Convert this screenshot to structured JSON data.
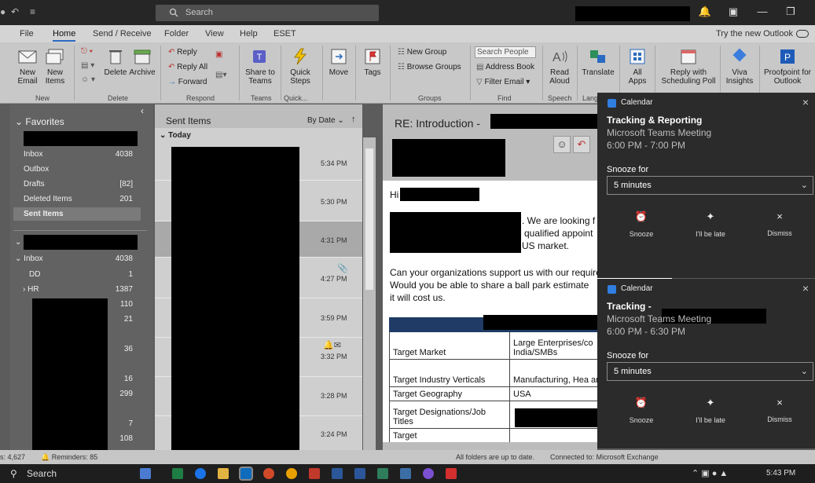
{
  "titlebar": {
    "search_placeholder": "Search"
  },
  "tabs": [
    "File",
    "Home",
    "Send / Receive",
    "Folder",
    "View",
    "Help",
    "ESET"
  ],
  "try_new": "Try the new Outlook",
  "ribbon": {
    "new_email": "New Email",
    "new_items": "New Items",
    "delete": "Delete",
    "archive": "Archive",
    "reply": "Reply",
    "reply_all": "Reply All",
    "forward": "Forward",
    "share_to_teams": "Share to Teams",
    "quick_steps": "Quick Steps",
    "move": "Move",
    "tags": "Tags",
    "new_group": "New Group",
    "browse_groups": "Browse Groups",
    "search_people": "Search People",
    "address_book": "Address Book",
    "filter_email": "Filter Email",
    "read_aloud": "Read Aloud",
    "translate": "Translate",
    "all_apps": "All Apps",
    "reply_scheduling": "Reply with Scheduling Poll",
    "viva_insights": "Viva Insights",
    "proofpoint": "Proofpoint for Outlook",
    "groups": {
      "new": "New",
      "delete": "Delete",
      "respond": "Respond",
      "teams": "Teams",
      "quick": "Quick...",
      "groups": "Groups",
      "find": "Find",
      "speech": "Speech",
      "lang": "Lang"
    }
  },
  "favorites": {
    "header": "Favorites",
    "items": [
      {
        "label": "Inbox",
        "count": "4038"
      },
      {
        "label": "Outbox",
        "count": ""
      },
      {
        "label": "Drafts",
        "count": "[82]"
      },
      {
        "label": "Deleted Items",
        "count": "201"
      },
      {
        "label": "Sent Items",
        "count": ""
      }
    ]
  },
  "mailbox": {
    "inbox": {
      "label": "Inbox",
      "count": "4038"
    },
    "folders": [
      {
        "label": "DD",
        "count": "1"
      },
      {
        "label": "HR",
        "count": "1387"
      }
    ],
    "counts": [
      "110",
      "21",
      "36",
      "16",
      "299",
      "7",
      "108"
    ]
  },
  "message_list": {
    "folder": "Sent Items",
    "sort": "By Date",
    "group": "Today",
    "times": [
      "5:34 PM",
      "5:30 PM",
      "4:31 PM",
      "4:27 PM",
      "3:59 PM",
      "3:32 PM",
      "3:28 PM",
      "3:24 PM"
    ]
  },
  "reading": {
    "subject": "RE: Introduction -",
    "greeting": "Hi",
    "line1": ". We are looking f",
    "line2": "qualified appoint",
    "line3": "US market.",
    "q1": "Can your organizations support us with our requirement?",
    "q2": "Would you be able to share a ball park estimate",
    "q3": "it will cost us.",
    "table": [
      [
        "Target Market",
        "Large Enterprises/co India/SMBs"
      ],
      [
        "Target Industry Verticals",
        "Manufacturing, Hea and IT"
      ],
      [
        "Target Geography",
        "USA"
      ],
      [
        "Target Designations/Job Titles",
        ""
      ],
      [
        "Target",
        ""
      ]
    ]
  },
  "toasts": [
    {
      "app": "Calendar",
      "title": "Tracking & Reporting",
      "subtitle": "Microsoft Teams Meeting",
      "time": "6:00 PM - 7:00 PM",
      "snooze_label": "Snooze for",
      "snooze_value": "5 minutes",
      "actions": [
        "Snooze",
        "I'll be late",
        "Dismiss"
      ]
    },
    {
      "app": "Calendar",
      "title": "Tracking -",
      "subtitle": "Microsoft Teams Meeting",
      "time": "6:00 PM - 6:30 PM",
      "snooze_label": "Snooze for",
      "snooze_value": "5 minutes",
      "actions": [
        "Snooze",
        "I'll be late",
        "Dismiss"
      ]
    }
  ],
  "status": {
    "items": "s: 4,627",
    "reminders": "Reminders: 85",
    "uptodate": "All folders are up to date.",
    "connected": "Connected to: Microsoft Exchange"
  },
  "taskbar": {
    "search": "Search",
    "clock": "5:43 PM"
  },
  "colors": {
    "accent": "#2a6ac0",
    "toast_bg": "#2b2b2b",
    "table_header": "#1f3b66"
  }
}
